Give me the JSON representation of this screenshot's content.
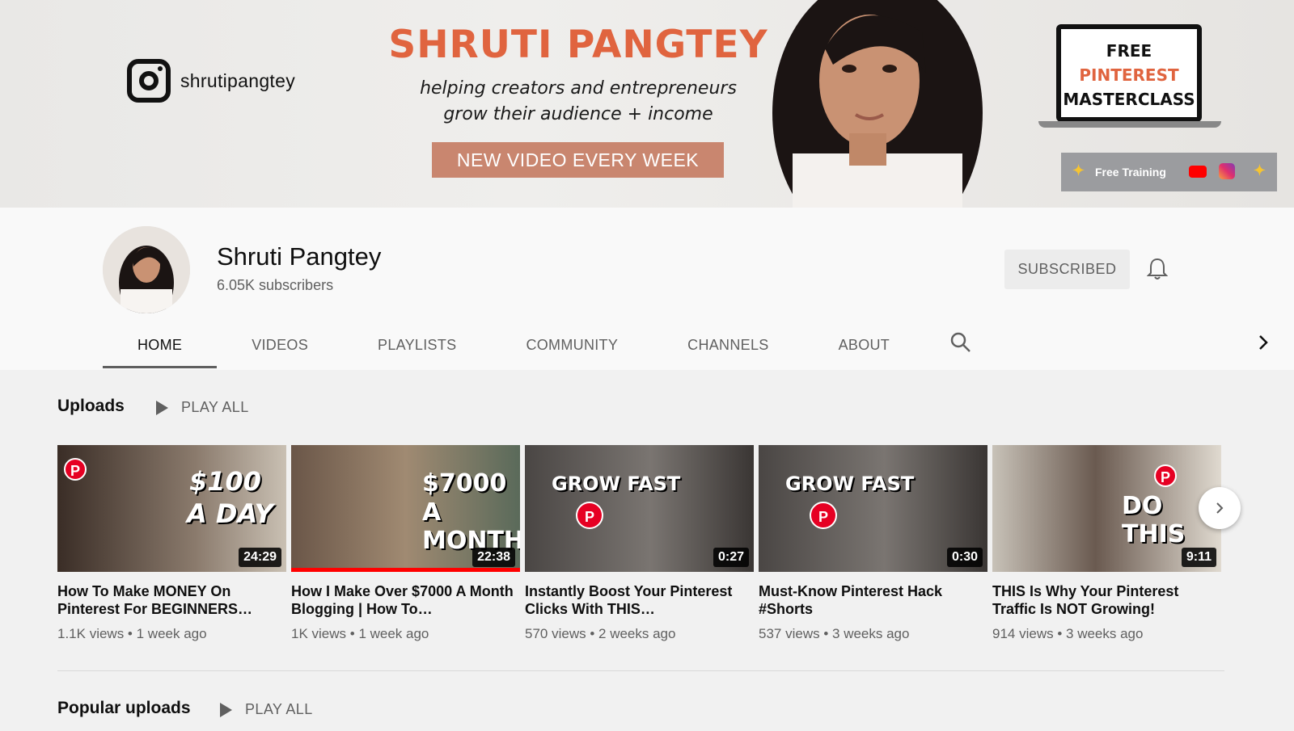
{
  "banner": {
    "instagram_handle": "shrutipangtey",
    "brand_name": "SHRUTI PANGTEY",
    "tagline_line1": "helping creators and entrepreneurs",
    "tagline_line2": "grow their audience + income",
    "weekly_label": "NEW VIDEO EVERY WEEK",
    "masterclass_line1": "FREE",
    "masterclass_line2": "PINTEREST",
    "masterclass_line3": "MASTERCLASS",
    "free_training_label": "Free Training",
    "accent_color": "#e0643f"
  },
  "channel": {
    "name": "Shruti Pangtey",
    "subscribers": "6.05K subscribers",
    "subscribe_label": "SUBSCRIBED"
  },
  "tabs": [
    {
      "label": "HOME",
      "active": true
    },
    {
      "label": "VIDEOS"
    },
    {
      "label": "PLAYLISTS"
    },
    {
      "label": "COMMUNITY"
    },
    {
      "label": "CHANNELS"
    },
    {
      "label": "ABOUT"
    }
  ],
  "uploads": {
    "title": "Uploads",
    "play_all": "PLAY ALL",
    "videos": [
      {
        "thumb_text_1": "$100",
        "thumb_text_2": "A DAY",
        "duration": "24:29",
        "title": "How To Make MONEY On Pinterest For BEGINNERS…",
        "views": "1.1K views",
        "age": "1 week ago",
        "progress": 0
      },
      {
        "thumb_text_1": "$7000",
        "thumb_text_2": "A MONTH",
        "duration": "22:38",
        "title": "How I Make Over $7000 A Month Blogging | How To…",
        "views": "1K views",
        "age": "1 week ago",
        "progress": 1.0
      },
      {
        "thumb_text_1": "GROW FAST",
        "thumb_text_2": "",
        "duration": "0:27",
        "title": "Instantly Boost Your Pinterest Clicks With THIS…",
        "views": "570 views",
        "age": "2 weeks ago",
        "progress": 0
      },
      {
        "thumb_text_1": "GROW FAST",
        "thumb_text_2": "",
        "duration": "0:30",
        "title": "Must-Know Pinterest Hack #Shorts",
        "views": "537 views",
        "age": "3 weeks ago",
        "progress": 0
      },
      {
        "thumb_text_1": "DO THIS",
        "thumb_text_2": "",
        "duration": "9:11",
        "title": "THIS Is Why Your Pinterest Traffic Is NOT Growing!",
        "views": "914 views",
        "age": "3 weeks ago",
        "progress": 0
      }
    ]
  },
  "popular": {
    "title": "Popular uploads",
    "play_all": "PLAY ALL"
  }
}
